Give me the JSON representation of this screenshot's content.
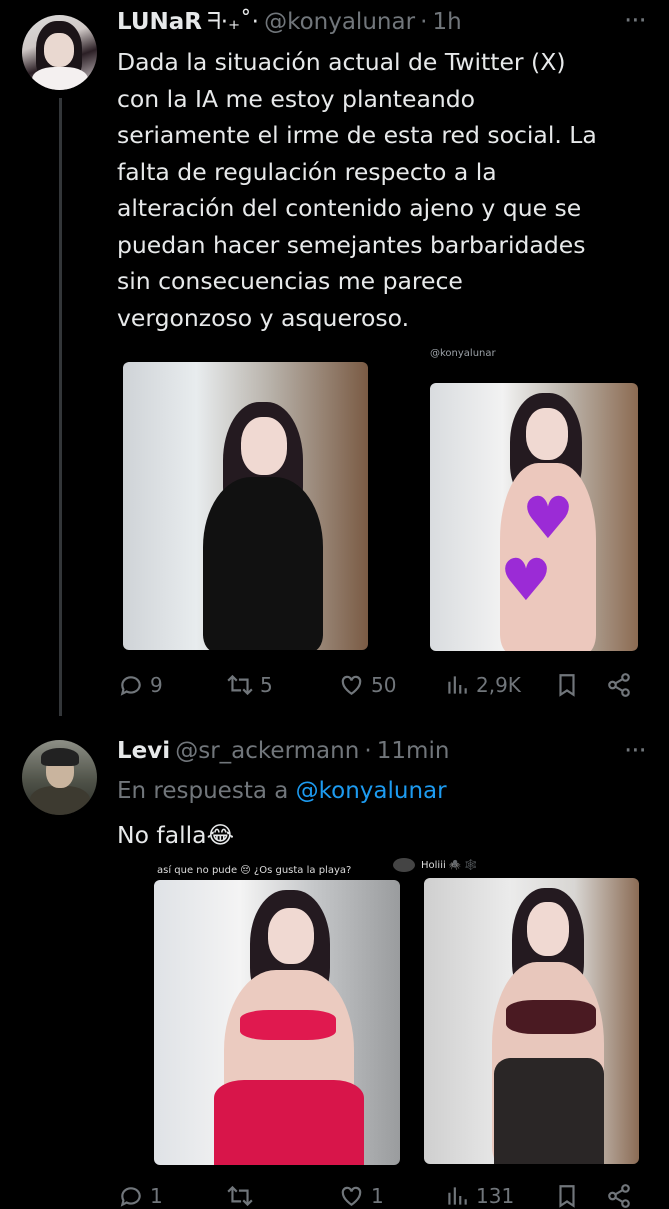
{
  "tweet1": {
    "display_name": "LUNaR",
    "name_decoration": "ᖷ·₊˚·",
    "handle": "@konyalunar",
    "separator": "·",
    "time": "1h",
    "more": "···",
    "text_lines": [
      "Dada la situación actual de Twitter (X)",
      "con la IA me estoy planteando",
      "seriamente el irme de esta red social. La",
      "falta de regulación respecto a la",
      "alteración del contenido ajeno y que se",
      "puedan hacer semejantes barbaridades",
      "sin consecuencias me parece",
      "vergonzoso y asqueroso."
    ],
    "image_watermark": "@konyalunar",
    "actions": {
      "replies": "9",
      "retweets": "5",
      "likes": "50",
      "views": "2,9K"
    },
    "icons": [
      "reply-icon",
      "retweet-icon",
      "like-icon",
      "views-icon",
      "bookmark-icon",
      "share-icon"
    ]
  },
  "tweet2": {
    "display_name": "Levi",
    "handle": "@sr_ackermann",
    "separator": "·",
    "time": "11min",
    "more": "···",
    "reply_prefix": "En respuesta a",
    "reply_to": "@konyalunar",
    "text": "No falla",
    "emoji": "😂",
    "image1_caption": "así que no pude 😔 ¿Os gusta la playa?",
    "image2_caption": "Holiii 🕷️ 🕸️",
    "actions": {
      "replies": "1",
      "retweets": "",
      "likes": "1",
      "views": "131"
    }
  },
  "colors": {
    "background": "#000000",
    "text": "#e7e9ea",
    "muted": "#71767b",
    "link": "#1d9bf0",
    "heart_censor": "#9b2bd6"
  }
}
